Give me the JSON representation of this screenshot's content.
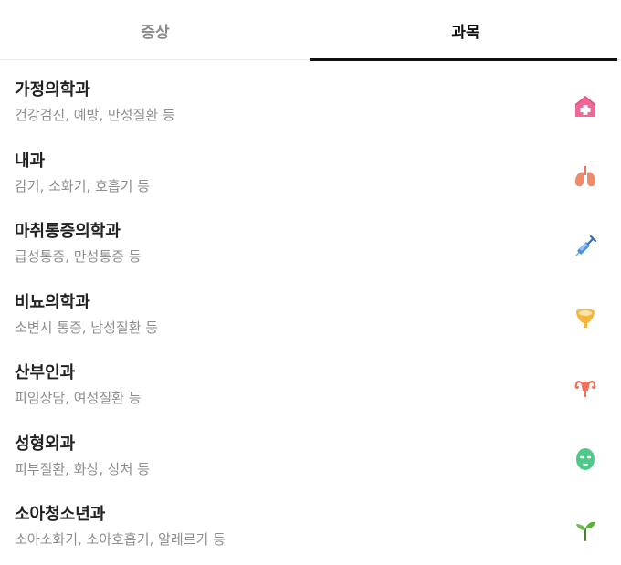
{
  "tabs": [
    {
      "label": "증상",
      "active": false
    },
    {
      "label": "과목",
      "active": true
    }
  ],
  "departments": [
    {
      "title": "가정의학과",
      "desc": "건강검진, 예방, 만성질환 등",
      "icon": "hospital-icon"
    },
    {
      "title": "내과",
      "desc": "감기, 소화기, 호흡기 등",
      "icon": "lungs-icon"
    },
    {
      "title": "마취통증의학과",
      "desc": "급성통증, 만성통증 등",
      "icon": "syringe-icon"
    },
    {
      "title": "비뇨의학과",
      "desc": "소변시 통증, 남성질환 등",
      "icon": "bladder-icon"
    },
    {
      "title": "산부인과",
      "desc": "피임상담, 여성질환 등",
      "icon": "uterus-icon"
    },
    {
      "title": "성형외과",
      "desc": "피부질환, 화상, 상처 등",
      "icon": "face-mask-icon"
    },
    {
      "title": "소아청소년과",
      "desc": "소아소화기, 소아호흡기, 알레르기 등",
      "icon": "sprout-icon"
    }
  ],
  "colors": {
    "active_tab": "#111111",
    "inactive_tab": "#8a8a8a",
    "desc_text": "#8e8e8e"
  }
}
